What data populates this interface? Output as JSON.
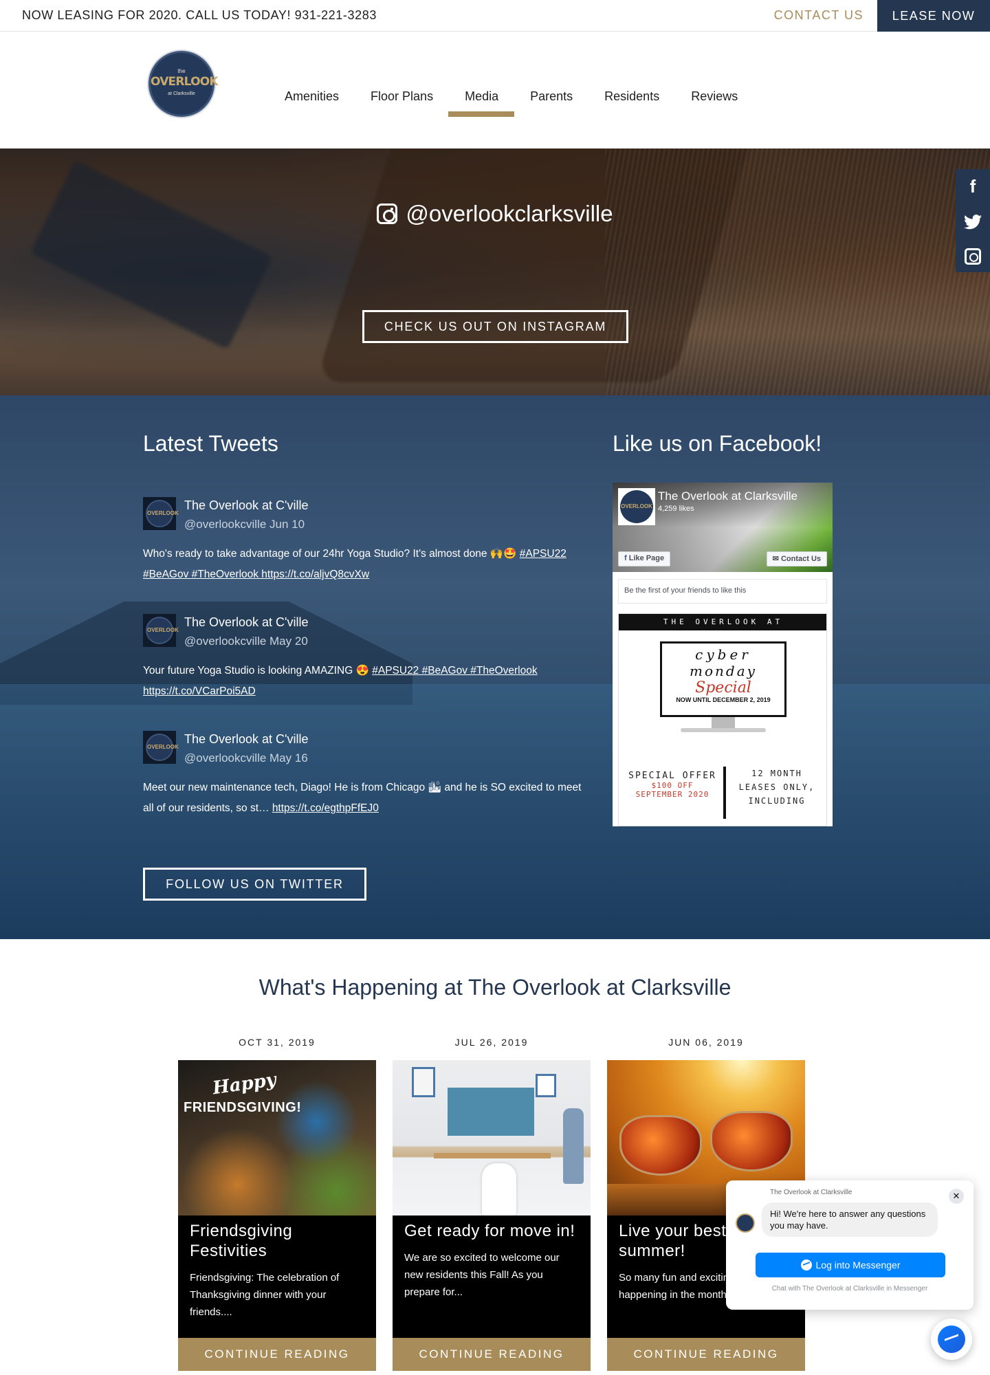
{
  "topbar": {
    "announcement": "NOW LEASING FOR 2020. CALL US TODAY! 931-221-3283",
    "contact_label": "CONTACT US",
    "lease_label": "LEASE NOW"
  },
  "logo": {
    "the": "the",
    "main": "OVERLOOK",
    "sub": "at Clarksville"
  },
  "nav": {
    "items": [
      "Amenities",
      "Floor Plans",
      "Media",
      "Parents",
      "Residents",
      "Reviews"
    ],
    "active": "Media",
    "accent_color": "#a88c5a"
  },
  "instagram": {
    "handle": "@overlookclarksville",
    "cta": "CHECK US OUT ON INSTAGRAM",
    "icon": "instagram-icon"
  },
  "social": {
    "icons": [
      "facebook-icon",
      "twitter-icon",
      "instagram-icon"
    ],
    "facebook_glyph": "f",
    "twitter_glyph": "🐦"
  },
  "tweets_section": {
    "title": "Latest Tweets",
    "follow_label": "FOLLOW US ON TWITTER",
    "tweets": [
      {
        "name": "The Overlook at C'ville",
        "meta": "@overlookcville Jun 10",
        "text": "Who's ready to take advantage of our 24hr Yoga Studio? It's almost done 🙌🤩 ",
        "links": "#APSU22 #BeAGov #TheOverlook https://t.co/aljvQ8cvXw"
      },
      {
        "name": "The Overlook at C'ville",
        "meta": "@overlookcville May 20",
        "text": "Your future Yoga Studio is looking AMAZING 😍 ",
        "links": "#APSU22 #BeAGov #TheOverlook https://t.co/VCarPoi5AD"
      },
      {
        "name": "The Overlook at C'ville",
        "meta": "@overlookcville May 16",
        "text": "Meet our new maintenance tech, Diago! He is from Chicago 🏙 and he is SO excited to meet all of our residents, so st… ",
        "links": "https://t.co/egthpFfEJ0"
      }
    ],
    "avatar_text": "OVERLOOK"
  },
  "facebook": {
    "title": "Like us on Facebook!",
    "page_name": "The Overlook at Clarksville",
    "likes": "4,259 likes",
    "like_button": "Like Page",
    "contact_button": "Contact Us",
    "friends_text": "Be the first of your friends to like this",
    "post_banner": "THE OVERLOOK AT CLARKSVILLE",
    "cyber_1": "cyber",
    "cyber_2": "monday",
    "cyber_3": "Special",
    "cyber_4": "NOW UNTIL DECEMBER 2, 2019",
    "offer_a": "SPECIAL OFFER",
    "offer_b": "$100 OFF",
    "offer_c": "SEPTEMBER 2020",
    "offer_right": "12 MONTH LEASES ONLY, INCLUDING"
  },
  "blog": {
    "title": "What's Happening at The Overlook at Clarksville",
    "read_label": "CONTINUE READING",
    "posts": [
      {
        "date": "OCT 31, 2019",
        "title": "Friendsgiving Festivities",
        "excerpt": "Friendsgiving: The celebration of Thanksgiving dinner with your friends....",
        "img_text_1": "Happy",
        "img_text_2": "FRIENDSGIVING!"
      },
      {
        "date": "JUL 26, 2019",
        "title": "Get ready for move in!",
        "excerpt": "We are so excited to welcome our new residents this Fall! As you prepare for..."
      },
      {
        "date": "JUN 06, 2019",
        "title": "Live your best summer!",
        "excerpt": "So many fun and exciting things happening in the month... starters,..."
      }
    ]
  },
  "messenger": {
    "page_name": "The Overlook at Clarksville",
    "greeting": "Hi! We're here to answer any questions you may have.",
    "login_label": "Log into Messenger",
    "note": "Chat with The Overlook at Clarksville in Messenger",
    "close_glyph": "✕"
  },
  "colors": {
    "navy": "#253650",
    "gold": "#a88c5a",
    "messenger_blue": "#0084ff"
  }
}
